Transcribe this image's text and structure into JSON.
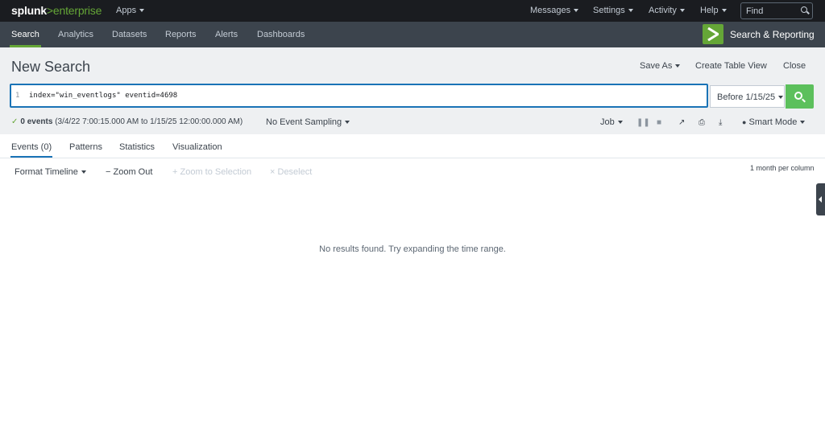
{
  "topbar": {
    "logo_main": "splunk",
    "logo_gt": ">",
    "logo_sub": "enterprise",
    "apps_label": "Apps",
    "nav": [
      "Messages",
      "Settings",
      "Activity",
      "Help"
    ],
    "find_placeholder": "Find"
  },
  "appbar": {
    "tabs": [
      "Search",
      "Analytics",
      "Datasets",
      "Reports",
      "Alerts",
      "Dashboards"
    ],
    "app_name": "Search & Reporting"
  },
  "search": {
    "title": "New Search",
    "save_as": "Save As",
    "create_table_view": "Create Table View",
    "close": "Close",
    "line_number": "1",
    "query": "index=\"win_eventlogs\" eventid=4698",
    "time_range": "Before 1/15/25",
    "event_count": "0 events",
    "time_span": "(3/4/22 7:00:15.000 AM to 1/15/25 12:00:00.000 AM)",
    "sampling": "No Event Sampling",
    "job": "Job",
    "mode": "Smart Mode"
  },
  "results": {
    "tabs": [
      "Events (0)",
      "Patterns",
      "Statistics",
      "Visualization"
    ],
    "format_timeline": "Format Timeline",
    "zoom_out": "Zoom Out",
    "zoom_selection": "Zoom to Selection",
    "deselect": "Deselect",
    "per_column": "1 month per column",
    "empty_message": "No results found. Try expanding the time range."
  },
  "colors": {
    "brand_green": "#65a637",
    "search_button": "#5cc05c",
    "focus_blue": "#1a73b6",
    "topbar": "#1a1c20",
    "appbar": "#3c444d"
  }
}
